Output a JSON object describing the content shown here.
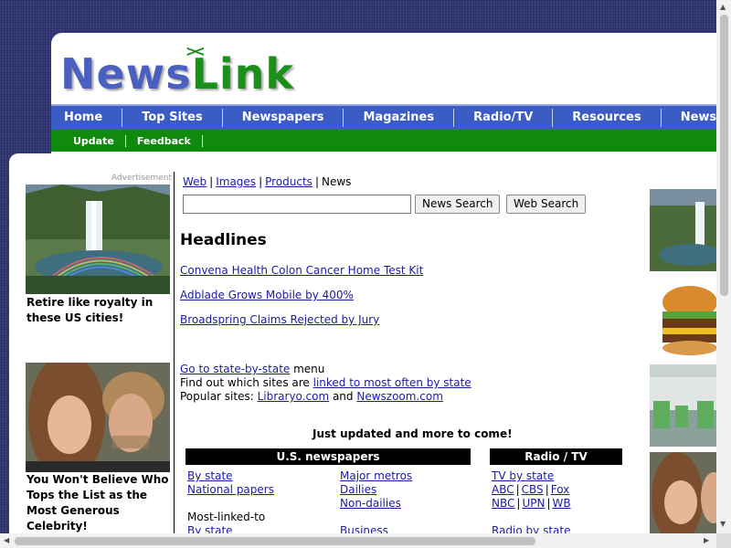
{
  "logo": {
    "news": "News",
    "link": "Link",
    "mark": "><"
  },
  "main_nav": [
    "Home",
    "Top Sites",
    "Newspapers",
    "Magazines",
    "Radio/TV",
    "Resources",
    "NewsCir"
  ],
  "sub_nav": [
    "Update",
    "Feedback"
  ],
  "left_ad": {
    "label": "Advertisement",
    "items": [
      {
        "caption": "Retire like royalty in these US cities!"
      },
      {
        "caption": "You Won't Believe Who Tops the List as the Most Generous Celebrity!"
      }
    ]
  },
  "search": {
    "tabs": [
      "Web",
      "Images",
      "Products",
      "News"
    ],
    "active_tab": "News",
    "input_value": "",
    "news_button": "News Search",
    "web_button": "Web Search"
  },
  "headlines": {
    "title": "Headlines",
    "items": [
      "Convena Health Colon Cancer Home Test Kit",
      "Adblade Grows Mobile by 400%",
      "Broadspring Claims Rejected by Jury"
    ]
  },
  "info": {
    "state_link": "Go to state-by-state",
    "state_suffix": " menu",
    "linked_prefix": "Find out which sites are ",
    "linked_link": "linked to most often by state",
    "popular_prefix": "Popular sites: ",
    "popular_a": "Libraryo.com",
    "popular_and": " and ",
    "popular_b": "Newszoom.com"
  },
  "updated_note": "Just updated and more to come!",
  "us_newspapers": {
    "title": "U.S. newspapers",
    "col1": [
      "By state",
      "National papers"
    ],
    "col2": [
      "Major metros",
      "Dailies",
      "Non-dailies"
    ],
    "most_linked": "Most-linked-to",
    "col1_more": "By state",
    "col2_more": "Business"
  },
  "radio_tv": {
    "title": "Radio / TV",
    "row1": "TV by state",
    "row2": [
      "ABC",
      "CBS",
      "Fox"
    ],
    "row3": [
      "NBC",
      "UPN",
      "WB"
    ],
    "row4": "Radio by state"
  },
  "colors": {
    "nav_blue": "#3b5cc4",
    "nav_green": "#0f8a0f",
    "logo_blue": "#4b5fc0",
    "logo_green": "#1a8f1a",
    "link": "#1a1aa6",
    "background": "#2b2f6b"
  },
  "icons": {
    "scroll_up": "scroll-up-arrow-icon",
    "scroll_down": "scroll-down-arrow-icon",
    "scroll_left": "scroll-left-arrow-icon",
    "scroll_right": "scroll-right-arrow-icon"
  }
}
